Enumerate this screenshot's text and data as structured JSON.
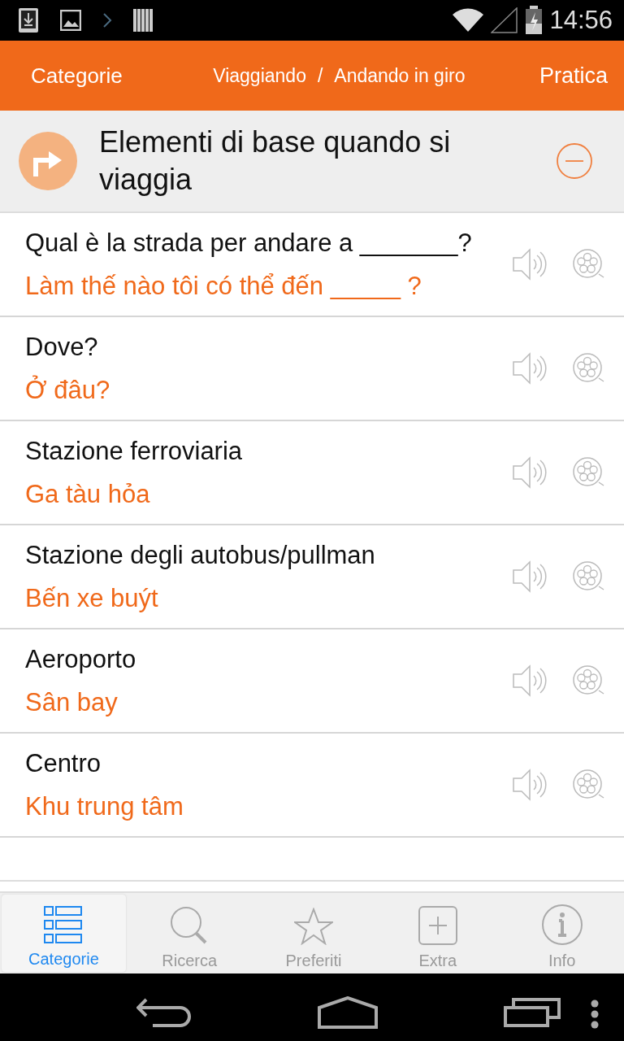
{
  "status_bar": {
    "time": "14:56"
  },
  "app_bar": {
    "back_label": "Categorie",
    "breadcrumb": [
      "Viaggiando",
      "Andando in giro"
    ],
    "separator": "/",
    "action_label": "Pratica"
  },
  "section": {
    "title": "Elementi di base quando si viaggia",
    "expanded": true
  },
  "phrases": [
    {
      "text": "Qual è la strada per andare a _______?",
      "translation": "Làm thế nào tôi có thể đến _____ ?"
    },
    {
      "text": "Dove?",
      "translation": "Ở đâu?"
    },
    {
      "text": "Stazione ferroviaria",
      "translation": "Ga tàu hỏa"
    },
    {
      "text": "Stazione degli autobus/pullman",
      "translation": "Bến xe buýt"
    },
    {
      "text": "Aeroporto",
      "translation": "Sân bay"
    },
    {
      "text": "Centro",
      "translation": "Khu trung tâm"
    }
  ],
  "tabs": [
    {
      "label": "Categorie",
      "kind": "list",
      "selected": true
    },
    {
      "label": "Ricerca",
      "kind": "search",
      "selected": false
    },
    {
      "label": "Preferiti",
      "kind": "star",
      "selected": false
    },
    {
      "label": "Extra",
      "kind": "plus",
      "selected": false
    },
    {
      "label": "Info",
      "kind": "info",
      "selected": false
    }
  ]
}
